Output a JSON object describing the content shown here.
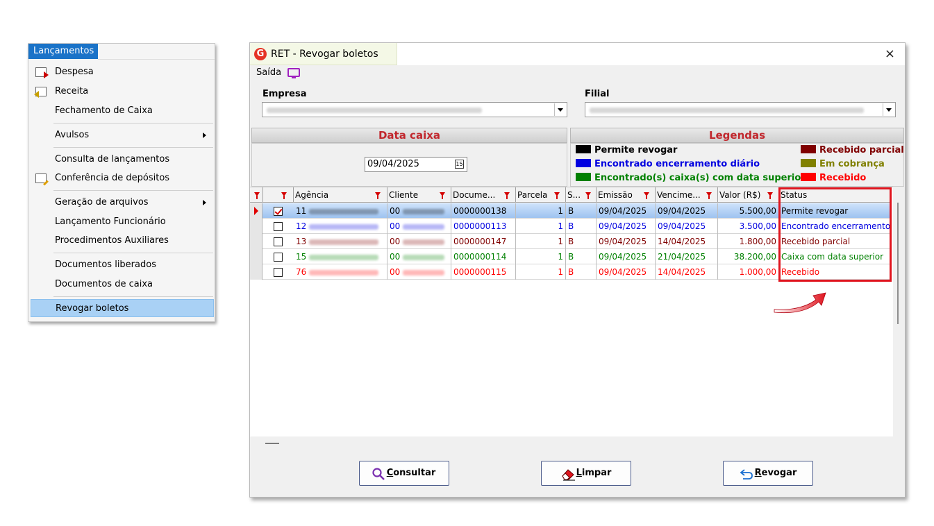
{
  "menu": {
    "title": "Lançamentos",
    "items": [
      {
        "label": "Despesa",
        "icon": "expense-doc-icon"
      },
      {
        "label": "Receita",
        "icon": "income-doc-icon"
      },
      {
        "label": "Fechamento de Caixa"
      },
      {
        "label": "Avulsos",
        "submenu": true
      },
      {
        "label": "Consulta de lançamentos"
      },
      {
        "label": "Conferência de depósitos",
        "icon": "edit-doc-icon"
      },
      {
        "label": "Geração de arquivos",
        "submenu": true
      },
      {
        "label": "Lançamento Funcionário"
      },
      {
        "label": "Procedimentos Auxiliares"
      },
      {
        "label": "Documentos liberados"
      },
      {
        "label": "Documentos de caixa"
      },
      {
        "label": "Revogar boletos",
        "selected": true
      }
    ]
  },
  "window": {
    "logo": "G",
    "title": "RET - Revogar boletos",
    "close": "×",
    "exit_label": "Saída"
  },
  "form": {
    "empresa_label": "Empresa",
    "filial_label": "Filial"
  },
  "data_caixa": {
    "header": "Data caixa",
    "date": "09/04/2025",
    "calendar_glyph": "15"
  },
  "legendas": {
    "header": "Legendas",
    "items": [
      {
        "label": "Permite revogar",
        "color": "#000000"
      },
      {
        "label": "Encontrado encerramento diário",
        "color": "#0000e0"
      },
      {
        "label": "Encontrado(s) caixa(s) com data superior",
        "color": "#008000"
      },
      {
        "label": "Recebido parcial",
        "color": "#800000"
      },
      {
        "label": "Em cobrança",
        "color": "#808000"
      },
      {
        "label": "Recebido",
        "color": "#ff0000"
      }
    ]
  },
  "grid": {
    "columns": [
      "Agência",
      "Cliente",
      "Docume...",
      "Parcela",
      "S...",
      "Emissão",
      "Vencime...",
      "Valor (R$)",
      "Status"
    ],
    "rows": [
      {
        "agencia": "11",
        "cliente": "00",
        "documento": "0000000138",
        "parcela": "1",
        "s": "B",
        "emissao": "09/04/2025",
        "vencimento": "09/04/2025",
        "valor": "5.500,00",
        "status": "Permite revogar",
        "color": "#000000",
        "checked": true,
        "current": true
      },
      {
        "agencia": "12",
        "cliente": "00",
        "documento": "0000000113",
        "parcela": "1",
        "s": "B",
        "emissao": "09/04/2025",
        "vencimento": "09/04/2025",
        "valor": "3.500,00",
        "status": "Encontrado encerramento",
        "color": "#0000e0",
        "checked": false
      },
      {
        "agencia": "13",
        "cliente": "00",
        "documento": "0000000147",
        "parcela": "1",
        "s": "B",
        "emissao": "09/04/2025",
        "vencimento": "14/04/2025",
        "valor": "1.800,00",
        "status": "Recebido parcial",
        "color": "#800000",
        "checked": false
      },
      {
        "agencia": "15",
        "cliente": "00",
        "documento": "0000000114",
        "parcela": "1",
        "s": "B",
        "emissao": "09/04/2025",
        "vencimento": "21/04/2025",
        "valor": "38.200,00",
        "status": "Caixa com data superior",
        "color": "#008000",
        "checked": false
      },
      {
        "agencia": "76",
        "cliente": "00",
        "documento": "0000000115",
        "parcela": "1",
        "s": "B",
        "emissao": "09/04/2025",
        "vencimento": "14/04/2025",
        "valor": "1.000,00",
        "status": "Recebido",
        "color": "#ff0000",
        "checked": false
      }
    ]
  },
  "buttons": {
    "consultar_u": "C",
    "consultar_rest": "onsultar",
    "limpar_u": "L",
    "limpar_rest": "impar",
    "revogar_u": "R",
    "revogar_rest": "evogar"
  },
  "colors": {
    "menu_title_bg": "#1a73c8",
    "selection": "#a9d1f5",
    "panel_header_text": "#c1272d",
    "highlight_box": "#e0141e"
  }
}
